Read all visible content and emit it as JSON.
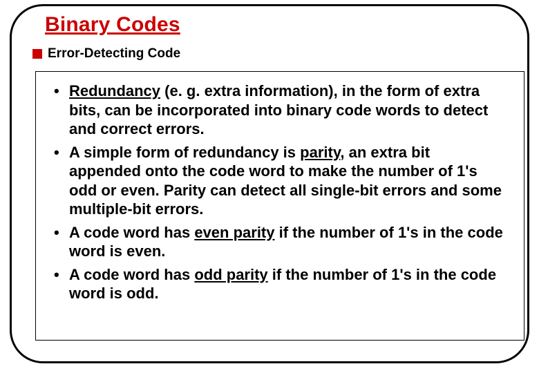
{
  "title": "Binary Codes",
  "subtitle": "Error-Detecting Code",
  "bullets": {
    "b1_u1": "Redundancy",
    "b1_rest": " (e. g. extra information), in the form of extra bits, can be incorporated into binary code words to detect and correct errors.",
    "b2_a": "A simple form of redundancy is ",
    "b2_u": "parity",
    "b2_b": ", an extra bit appended onto the code word to make the number of 1's odd or even. Parity can detect all single-bit errors and some multiple-bit errors.",
    "b3_a": "A code word has ",
    "b3_u": "even parity",
    "b3_b": " if the number of 1's in the code word is even.",
    "b4_a": "A code word has ",
    "b4_u": "odd parity",
    "b4_b": " if the number of 1's in the code word is odd."
  }
}
